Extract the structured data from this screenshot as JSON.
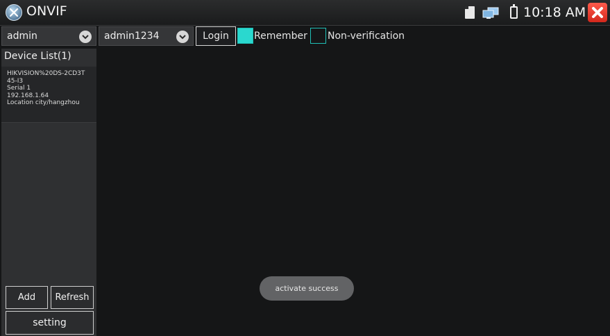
{
  "app": {
    "title": "ONVIF",
    "icon": "onvif-logo-icon"
  },
  "status_bar": {
    "time": "10:18 AM",
    "icons": [
      "sd-card-icon",
      "network-icon",
      "battery-icon",
      "close-icon"
    ]
  },
  "toolbar": {
    "username": {
      "value": "admin",
      "icon": "chevron-down-icon"
    },
    "password": {
      "value": "admin1234",
      "icon": "chevron-down-icon"
    },
    "login_label": "Login",
    "remember": {
      "label": "Remember",
      "checked": true
    },
    "non_verification": {
      "label": "Non-verification",
      "checked": false
    }
  },
  "sidebar": {
    "header": "Device List(1)",
    "devices": [
      {
        "name_line1": "HIKVISION%20DS-2CD3T",
        "name_line2": "45-I3",
        "serial": "Serial 1",
        "ip": "192.168.1.64",
        "location": "Location city/hangzhou"
      }
    ],
    "add_label": "Add",
    "refresh_label": "Refresh",
    "setting_label": "setting"
  },
  "toast": {
    "message": "activate success"
  },
  "colors": {
    "accent": "#2ad8cf",
    "close": "#e0372a",
    "background": "#151617"
  }
}
